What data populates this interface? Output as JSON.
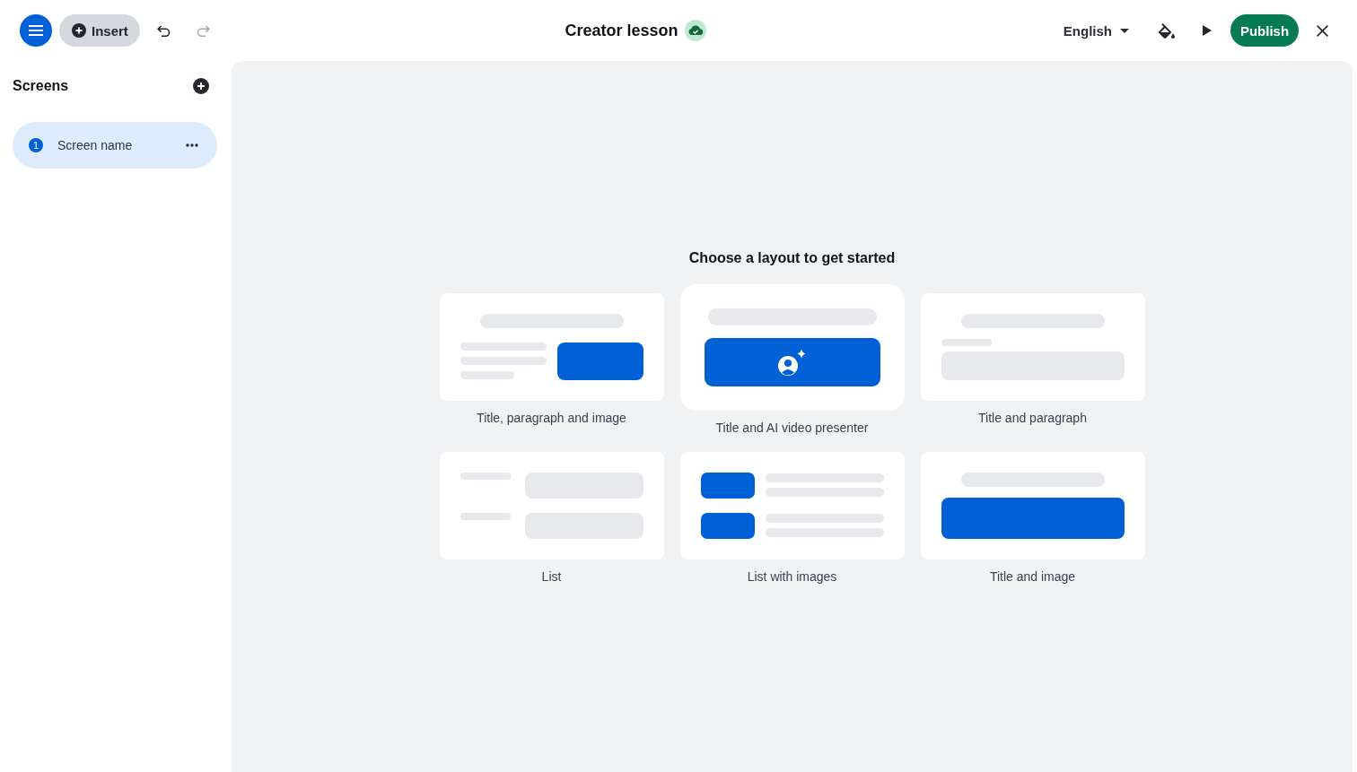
{
  "toolbar": {
    "insert": "Insert",
    "undo": {
      "disabled": false
    },
    "redo": {
      "disabled": true
    }
  },
  "document": {
    "title": "Creator lesson",
    "saved": true
  },
  "actions": {
    "language": "English",
    "publish": "Publish"
  },
  "sidebar": {
    "title": "Screens",
    "screens": [
      {
        "number": "1",
        "name": "Screen name",
        "selected": true
      }
    ]
  },
  "canvas": {
    "heading": "Choose a layout to get started",
    "layouts": [
      {
        "kind": "textimage",
        "label": "Title, paragraph and image"
      },
      {
        "kind": "presenter",
        "label": "Title and AI video presenter"
      },
      {
        "kind": "paragraph",
        "label": "Title and paragraph"
      },
      {
        "kind": "list",
        "label": "List"
      },
      {
        "kind": "imagelist",
        "label": "List with images"
      },
      {
        "kind": "image",
        "label": "Title and image"
      }
    ]
  }
}
